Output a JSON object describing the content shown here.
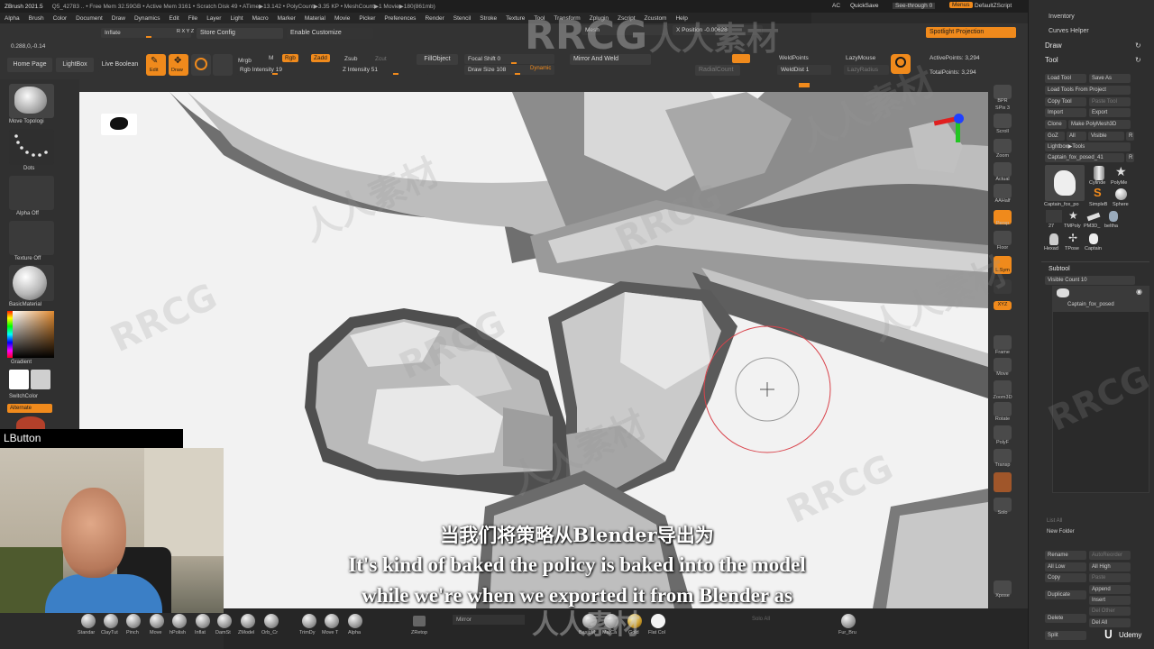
{
  "menubar": {
    "app_title": "ZBrush 2021.5",
    "status": "Q5_42783  .. • Free Mem 32.59GB • Active Mem 3161 • Scratch Disk 49 • ATime▶13.142 • PolyCount▶3.35 KP • MeshCount▶1  Movie▶180(861mb)",
    "menus": [
      "Alpha",
      "Brush",
      "Color",
      "Document",
      "Draw",
      "Dynamics",
      "Edit",
      "File",
      "Layer",
      "Light",
      "Macro",
      "Marker",
      "Material",
      "Movie",
      "Picker",
      "Preferences",
      "Render",
      "Stencil",
      "Stroke",
      "Texture",
      "Tool",
      "Transform",
      "Zplugin",
      "Zscript",
      "Zcustom",
      "Help"
    ],
    "ac": "AC",
    "quicksave": "QuickSave",
    "see_through": "See-through  0",
    "menus_btn": "Menus",
    "default_zscript": "DefaultZScript"
  },
  "topbar": {
    "inflate": "Inflate",
    "xyz": "R X Y Z",
    "store_config": "Store Config",
    "enable_customize": "Enable Customize",
    "mesh": "Mesh",
    "x_position": "X Position -0.00628",
    "coords": "0.288,0,-0.14",
    "home_page": "Home Page",
    "lightbox": "LightBox",
    "live_boolean": "Live Boolean",
    "edit": "Edit",
    "draw": "Draw",
    "m": "M",
    "mrgb": "Mrgb",
    "rgb": "Rgb",
    "zadd": "Zadd",
    "zsub": "Zsub",
    "zcut": "Zcut",
    "rgb_intensity": "Rgb Intensity 19",
    "z_intensity": "Z Intensity 51",
    "fillobject": "FillObject",
    "focal_shift": "Focal Shift 0",
    "draw_size": "Draw Size 108",
    "dynamic": "Dynamic",
    "mirror_weld": "Mirror And Weld",
    "weldpoints": "WeldPoints",
    "welddist": "WeldDist 1",
    "radialcount": "RadialCount",
    "lazymouse": "LazyMouse",
    "lazyradius": "LazyRadius",
    "spotlight": "Spotlight Projection",
    "active_points": "ActivePoints: 3,294",
    "total_points": "TotalPoints: 3,294"
  },
  "leftbar": {
    "move_topology": "Move Topologi",
    "dots": "Dots",
    "alpha_off": "Alpha Off",
    "texture_off": "Texture Off",
    "basic_material": "BasicMaterial",
    "gradient": "Gradient",
    "switch_color": "SwitchColor",
    "alternate": "Alternate"
  },
  "overlay": {
    "lbutton": "LButton"
  },
  "rightshelf": [
    "BPR",
    "SPix 3",
    "Scroll",
    "Zoom",
    "Actual",
    "AAHalf",
    "Persp",
    "Floor",
    "L.Sym",
    "XYZ",
    "Frame",
    "Move",
    "Zoom3D",
    "Rotate",
    "PolyF",
    "Transp",
    "Solo",
    "Xpose"
  ],
  "panel": {
    "inventory": "Inventory",
    "curves_helper": "Curves Helper",
    "draw": "Draw",
    "tool": "Tool",
    "load_tool": "Load Tool",
    "save_as": "Save As",
    "load_from_project": "Load Tools From Project",
    "copy_tool": "Copy Tool",
    "paste_tool": "Paste Tool",
    "import": "Import",
    "export": "Export",
    "clone": "Clone",
    "make_polymesh": "Make PolyMesh3D",
    "goz": "GoZ",
    "all": "All",
    "visible": "Visible",
    "r": "R",
    "lightbox_tools": "Lightbox▶Tools",
    "current_tool": "Captain_fox_posed_41",
    "current_tool_r": "R",
    "thumbs": [
      "Captain_fox_po",
      "Cylinde",
      "PolyMe",
      "SimpleB",
      "Sphere",
      "27",
      "TMPoly",
      "PM3D_",
      "beltha",
      "Hexad",
      "TPose",
      "Captain"
    ],
    "subtool": "Subtool",
    "visible_count": "Visible Count 10",
    "subtool_item": "Captain_fox_posed",
    "list_all": "List All",
    "new_folder": "New Folder",
    "rename": "Rename",
    "autoreorder": "AutoReorder",
    "all_low": "All Low",
    "all_high": "All High",
    "copy": "Copy",
    "paste": "Paste",
    "duplicate": "Duplicate",
    "append": "Append",
    "insert": "Insert",
    "del_other": "Del Other",
    "delete": "Delete",
    "del_all": "Del All",
    "split": "Split",
    "udemy": "Udemy"
  },
  "bottombar": {
    "brushes": [
      "Standar",
      "ClayTut",
      "Pinch",
      "Move",
      "hPolish",
      "Inflat",
      "DamSt",
      "ZModel",
      "Orb_Cr",
      "TrimDy",
      "Move T",
      "Alpha",
      "ZRetop"
    ],
    "mirror": "Mirror",
    "solo_all": "Solo All",
    "materials": [
      "BasicM",
      "MatCa",
      "Gold",
      "Flat Col"
    ],
    "fur": "Fur_Bru"
  },
  "subtitles": {
    "chinese": "当我们将策略从Blender导出为",
    "english_1": "It's kind of baked the policy is baked into the model",
    "english_2": "while we're when we exported it from Blender as"
  },
  "watermarks": {
    "rrcg": "RRCG",
    "cn": "人人素材"
  },
  "colors": {
    "accent": "#f08a1c",
    "viewport_bg": "#f2f2f2",
    "ui_bg": "#333333",
    "brush_ring": "#d9434b"
  }
}
